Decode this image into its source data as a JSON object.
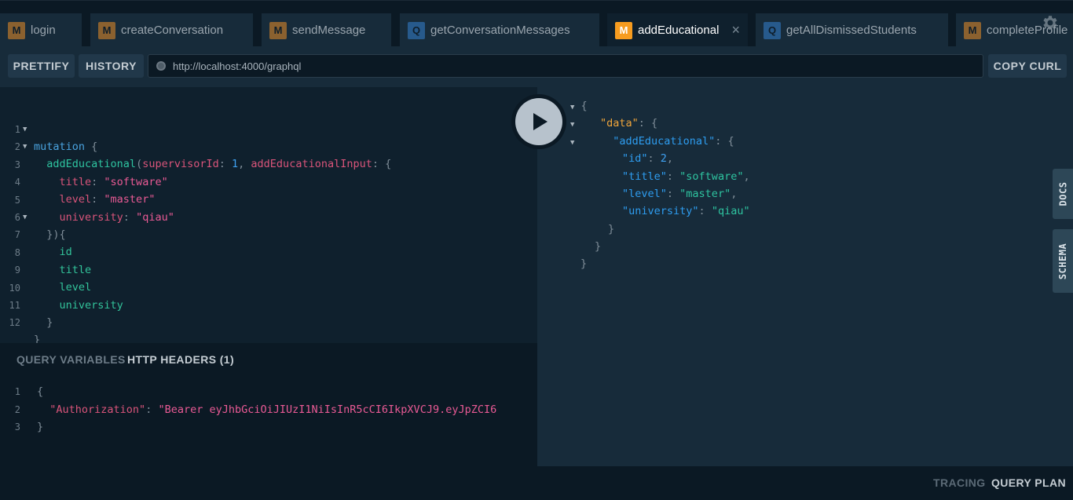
{
  "tabs": [
    {
      "badge": "M",
      "label": "login"
    },
    {
      "badge": "M",
      "label": "createConversation"
    },
    {
      "badge": "M",
      "label": "sendMessage"
    },
    {
      "badge": "Q",
      "label": "getConversationMessages"
    },
    {
      "badge": "M",
      "label": "addEducational",
      "close": "×"
    },
    {
      "badge": "Q",
      "label": "getAllDismissedStudents"
    },
    {
      "badge": "M",
      "label": "completeProfile"
    }
  ],
  "toolbar": {
    "prettify_label": "PRETTIFY",
    "history_label": "HISTORY",
    "url": "http://localhost:4000/graphql",
    "copy_curl_label": "COPY CURL"
  },
  "editor": {
    "line_numbers": [
      "1",
      "2",
      "3",
      "4",
      "5",
      "6",
      "7",
      "8",
      "9",
      "10",
      "11",
      "12"
    ],
    "mutation_kw": "mutation",
    "op_name": "addEducational",
    "arg1_name": "supervisorId",
    "arg1_value": "1",
    "arg2_name": "addEducationalInput",
    "input_fields": [
      {
        "name": "title",
        "value": "\"software\""
      },
      {
        "name": "level",
        "value": "\"master\""
      },
      {
        "name": "university",
        "value": "\"qiau\""
      }
    ],
    "selection": [
      "id",
      "title",
      "level",
      "university"
    ]
  },
  "result": {
    "data_key": "\"data\"",
    "op_key": "\"addEducational\"",
    "fields": [
      {
        "key": "\"id\"",
        "value": "2",
        "type": "num"
      },
      {
        "key": "\"title\"",
        "value": "\"software\"",
        "type": "str"
      },
      {
        "key": "\"level\"",
        "value": "\"master\"",
        "type": "str"
      },
      {
        "key": "\"university\"",
        "value": "\"qiau\"",
        "type": "str"
      }
    ]
  },
  "side_tabs": {
    "docs": "DOCS",
    "schema": "SCHEMA"
  },
  "variables": {
    "query_variables_label": "QUERY VARIABLES",
    "http_headers_label": "HTTP HEADERS (1)",
    "line_numbers": [
      "1",
      "2",
      "3"
    ],
    "header_key": "\"Authorization\"",
    "header_value": "\"Bearer eyJhbGciOiJIUzI1NiIsInR5cCI6IkpXVCJ9.eyJpZCI6"
  },
  "footer": {
    "tracing_label": "TRACING",
    "query_plan_label": "QUERY PLAN"
  },
  "colors": {
    "accent_mutation": "#f79c1f",
    "query_badge": "#2d6aa8",
    "background": "#0f202d"
  }
}
